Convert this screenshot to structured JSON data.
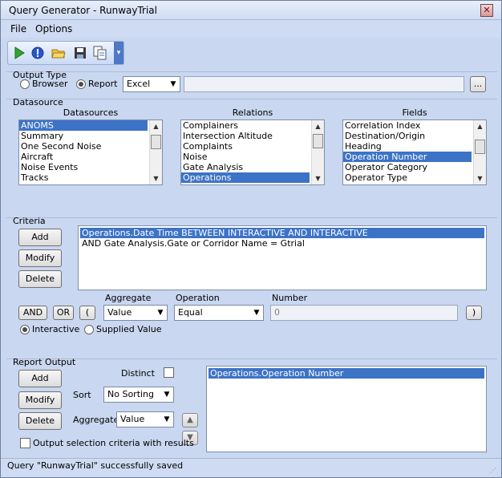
{
  "window": {
    "title": "Query Generator - RunwayTrial",
    "close_label": "✕"
  },
  "menu": {
    "file": "File",
    "options": "Options"
  },
  "toolbar": {
    "icons": [
      "run-icon",
      "stop-icon",
      "open-folder-icon",
      "save-icon",
      "copy-icon"
    ],
    "overflow_label": "▾"
  },
  "output_type": {
    "label": "Output Type",
    "browser": "Browser",
    "report": "Report",
    "format_value": "Excel",
    "path_value": "",
    "browse_label": "..."
  },
  "datasource": {
    "label": "Datasource",
    "datasources_header": "Datasources",
    "relations_header": "Relations",
    "fields_header": "Fields",
    "datasources": [
      "ANOMS",
      "Summary",
      "One Second Noise",
      "Aircraft",
      "Noise Events",
      "Tracks"
    ],
    "relations": [
      "Complainers",
      "Intersection Altitude",
      "Complaints",
      "Noise",
      "Gate Analysis",
      "Operations"
    ],
    "fields": [
      "Correlation Index",
      "Destination/Origin",
      "Heading",
      "Operation Number",
      "Operator Category",
      "Operator Type"
    ]
  },
  "criteria": {
    "label": "Criteria",
    "add": "Add",
    "modify": "Modify",
    "delete": "Delete",
    "lines": [
      "Operations.Date Time BETWEEN INTERACTIVE AND INTERACTIVE",
      "AND Gate Analysis.Gate or Corridor Name = Gtrial"
    ],
    "and": "AND",
    "or": "OR",
    "open_paren": "(",
    "close_paren": ")",
    "aggregate_label": "Aggregate",
    "aggregate_value": "Value",
    "operation_label": "Operation",
    "operation_value": "Equal",
    "number_label": "Number",
    "number_value": "0",
    "interactive": "Interactive",
    "supplied_value": "Supplied Value"
  },
  "report_output": {
    "label": "Report Output",
    "add": "Add",
    "modify": "Modify",
    "delete": "Delete",
    "distinct": "Distinct",
    "sort_label": "Sort",
    "sort_value": "No Sorting",
    "aggregate_label": "Aggregate",
    "aggregate_value": "Value",
    "output_criteria": "Output selection criteria with results",
    "items": [
      "Operations.Operation Number"
    ]
  },
  "status": {
    "text": "Query \"RunwayTrial\" successfully saved"
  }
}
